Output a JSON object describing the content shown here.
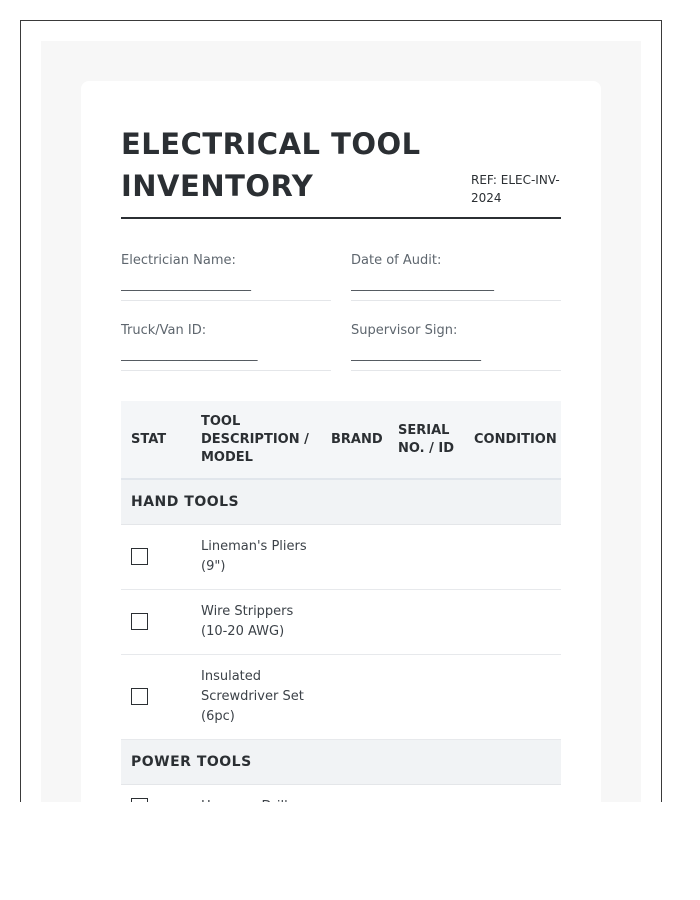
{
  "document": {
    "title": "ELECTRICAL TOOL INVENTORY",
    "ref": "REF: ELEC-INV-2024"
  },
  "fields": [
    {
      "label": "Electrician Name:",
      "line": "____________________"
    },
    {
      "label": "Date of Audit:",
      "line": "______________________"
    },
    {
      "label": "Truck/Van ID:",
      "line": "_____________________"
    },
    {
      "label": "Supervisor Sign:",
      "line": "____________________"
    }
  ],
  "table": {
    "headers": [
      "STAT",
      "TOOL DESCRIPTION / MODEL",
      "BRAND",
      "SERIAL NO. / ID",
      "CONDITION"
    ],
    "sections": [
      {
        "name": "HAND TOOLS",
        "items": [
          {
            "description": "Lineman's Pliers (9\")"
          },
          {
            "description": "Wire Strippers (10-20 AWG)"
          },
          {
            "description": "Insulated Screwdriver Set (6pc)"
          }
        ]
      },
      {
        "name": "POWER TOOLS",
        "items": [
          {
            "description": "Hammer Drill"
          }
        ]
      }
    ]
  }
}
